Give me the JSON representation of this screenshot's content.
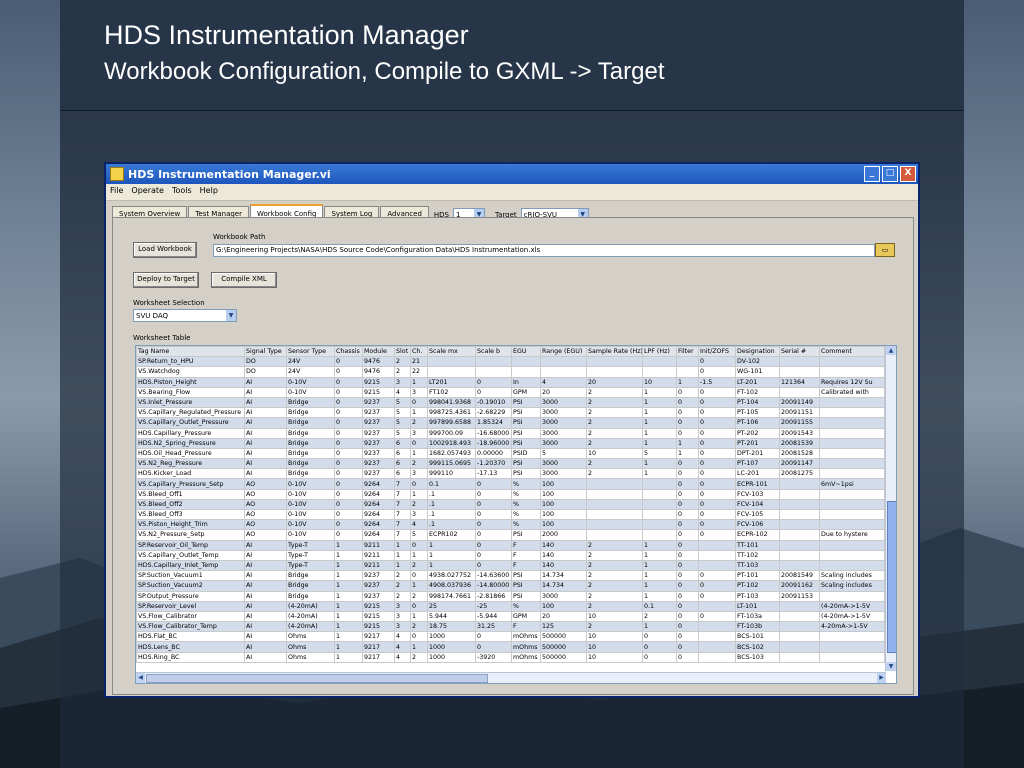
{
  "slide": {
    "title": "HDS Instrumentation Manager",
    "subtitle": "Workbook Configuration, Compile to GXML -> Target"
  },
  "window": {
    "title": "HDS Instrumentation Manager.vi",
    "controls": {
      "minimize": "_",
      "maximize": "□",
      "close": "X"
    }
  },
  "menu": [
    "File",
    "Operate",
    "Tools",
    "Help"
  ],
  "tabs": [
    "System Overview",
    "Test Manager",
    "Workbook Config",
    "System Log",
    "Advanced"
  ],
  "active_tab": "Workbook Config",
  "hds": {
    "label": "HDS",
    "value": "1"
  },
  "target": {
    "label": "Target",
    "value": "cRIO-SVU"
  },
  "workbook": {
    "path_label": "Workbook Path",
    "path_value": "G:\\Engineering Projects\\NASA\\HDS Source Code\\Configuration Data\\HDS Instrumentation.xls",
    "load_button": "Load Workbook",
    "deploy_button": "Deploy to Target",
    "compile_button": "Compile XML"
  },
  "worksheet": {
    "selection_label": "Worksheet Selection",
    "selection_value": "SVU DAQ",
    "table_label": "Worksheet Table"
  },
  "table": {
    "columns": [
      "Tag Name",
      "Signal Type",
      "Sensor Type",
      "Chassis",
      "Module",
      "Slot",
      "Ch.",
      "Scale mx",
      "Scale b",
      "EGU",
      "Range (EGU)",
      "Sample Rate (Hz)",
      "LPF (Hz)",
      "Filter",
      "Init/ZOFS",
      "Designation",
      "Serial #",
      "Comment"
    ],
    "rows": [
      [
        "SP.Return_to_HPU",
        "DO",
        "24V",
        "0",
        "9476",
        "2",
        "21",
        "",
        "",
        "",
        "",
        "",
        "",
        "",
        "0",
        "DV-102",
        "",
        ""
      ],
      [
        "VS.Watchdog",
        "DO",
        "24V",
        "0",
        "9476",
        "2",
        "22",
        "",
        "",
        "",
        "",
        "",
        "",
        "",
        "0",
        "WG-101",
        "",
        ""
      ],
      [
        "HDS.Piston_Height",
        "AI",
        "0-10V",
        "0",
        "9215",
        "3",
        "1",
        "LT201",
        "0",
        "In",
        "4",
        "20",
        "10",
        "1",
        "-1.5",
        "LT-201",
        "121364",
        "Requires 12V Su"
      ],
      [
        "VS.Bearing_Flow",
        "AI",
        "0-10V",
        "0",
        "9215",
        "4",
        "3",
        "FT102",
        "0",
        "GPM",
        "20",
        "2",
        "1",
        "0",
        "0",
        "FT-102",
        "",
        "Calibrated with"
      ],
      [
        "VS.Inlet_Pressure",
        "AI",
        "Bridge",
        "0",
        "9237",
        "5",
        "0",
        "998041.9368",
        "-0.19010",
        "PSI",
        "3000",
        "2",
        "1",
        "0",
        "0",
        "PT-104",
        "20091149",
        ""
      ],
      [
        "VS.Capillary_Regulated_Pressure",
        "AI",
        "Bridge",
        "0",
        "9237",
        "5",
        "1",
        "998725.4361",
        "-2.68229",
        "PSI",
        "3000",
        "2",
        "1",
        "0",
        "0",
        "PT-105",
        "20091151",
        ""
      ],
      [
        "VS.Capillary_Outlet_Pressure",
        "AI",
        "Bridge",
        "0",
        "9237",
        "5",
        "2",
        "997899.6588",
        "1.85324",
        "PSI",
        "3000",
        "2",
        "1",
        "0",
        "0",
        "PT-106",
        "20091155",
        ""
      ],
      [
        "HDS.Capillary_Pressure",
        "AI",
        "Bridge",
        "0",
        "9237",
        "5",
        "3",
        "999700.09",
        "-16.68000",
        "PSI",
        "3000",
        "2",
        "1",
        "0",
        "0",
        "PT-202",
        "20091543",
        ""
      ],
      [
        "HDS.N2_Spring_Pressure",
        "AI",
        "Bridge",
        "0",
        "9237",
        "6",
        "0",
        "1002918.493",
        "-18.96000",
        "PSI",
        "3000",
        "2",
        "1",
        "1",
        "0",
        "PT-201",
        "20081539",
        ""
      ],
      [
        "HDS.Oil_Head_Pressure",
        "AI",
        "Bridge",
        "0",
        "9237",
        "6",
        "1",
        "1682.057493",
        "0.00000",
        "PSID",
        "5",
        "10",
        "5",
        "1",
        "0",
        "DPT-201",
        "20081528",
        ""
      ],
      [
        "VS.N2_Reg_Pressure",
        "AI",
        "Bridge",
        "0",
        "9237",
        "6",
        "2",
        "999115.0695",
        "-1.20370",
        "PSI",
        "3000",
        "2",
        "1",
        "0",
        "0",
        "PT-107",
        "20091147",
        ""
      ],
      [
        "HDS.Kicker_Load",
        "AI",
        "Bridge",
        "0",
        "9237",
        "6",
        "3",
        "999110",
        "-17.13",
        "PSI",
        "3000",
        "2",
        "1",
        "0",
        "0",
        "LC-201",
        "20081275",
        ""
      ],
      [
        "VS.Capillary_Pressure_Setp",
        "AO",
        "0-10V",
        "0",
        "9264",
        "7",
        "0",
        "0.1",
        "0",
        "%",
        "100",
        "",
        "",
        "0",
        "0",
        "ECPR-101",
        "",
        "6mV~1psi"
      ],
      [
        "VS.Bleed_Off1",
        "AO",
        "0-10V",
        "0",
        "9264",
        "7",
        "1",
        ".1",
        "0",
        "%",
        "100",
        "",
        "",
        "0",
        "0",
        "FCV-103",
        "",
        ""
      ],
      [
        "VS.Bleed_Off2",
        "AO",
        "0-10V",
        "0",
        "9264",
        "7",
        "2",
        ".1",
        "0",
        "%",
        "100",
        "",
        "",
        "0",
        "0",
        "FCV-104",
        "",
        ""
      ],
      [
        "VS.Bleed_Off3",
        "AO",
        "0-10V",
        "0",
        "9264",
        "7",
        "3",
        ".1",
        "0",
        "%",
        "100",
        "",
        "",
        "0",
        "0",
        "FCV-105",
        "",
        ""
      ],
      [
        "VS.Piston_Height_Trim",
        "AO",
        "0-10V",
        "0",
        "9264",
        "7",
        "4",
        ".1",
        "0",
        "%",
        "100",
        "",
        "",
        "0",
        "0",
        "FCV-106",
        "",
        ""
      ],
      [
        "VS.N2_Pressure_Setp",
        "AO",
        "0-10V",
        "0",
        "9264",
        "7",
        "5",
        "ECPR102",
        "0",
        "PSI",
        "2000",
        "",
        "",
        "0",
        "0",
        "ECPR-102",
        "",
        "Due to hystere"
      ],
      [
        "SP.Reservoir_Oil_Temp",
        "AI",
        "Type-T",
        "1",
        "9211",
        "1",
        "0",
        "1",
        "0",
        "F",
        "140",
        "2",
        "1",
        "0",
        "",
        "TT-101",
        "",
        ""
      ],
      [
        "VS.Capillary_Outlet_Temp",
        "AI",
        "Type-T",
        "1",
        "9211",
        "1",
        "1",
        "1",
        "0",
        "F",
        "140",
        "2",
        "1",
        "0",
        "",
        "TT-102",
        "",
        ""
      ],
      [
        "HDS.Capillary_Inlet_Temp",
        "AI",
        "Type-T",
        "1",
        "9211",
        "1",
        "2",
        "1",
        "0",
        "F",
        "140",
        "2",
        "1",
        "0",
        "",
        "TT-103",
        "",
        ""
      ],
      [
        "SP.Suction_Vacuum1",
        "AI",
        "Bridge",
        "1",
        "9237",
        "2",
        "0",
        "4938.027752",
        "-14.63600",
        "PSI",
        "14.734",
        "2",
        "1",
        "0",
        "0",
        "PT-101",
        "20081549",
        "Scaling includes"
      ],
      [
        "SP.Suction_Vacuum2",
        "AI",
        "Bridge",
        "1",
        "9237",
        "2",
        "1",
        "4908.037936",
        "-14.80000",
        "PSI",
        "14.734",
        "2",
        "1",
        "0",
        "0",
        "PT-102",
        "20091162",
        "Scaling includes"
      ],
      [
        "SP.Output_Pressure",
        "AI",
        "Bridge",
        "1",
        "9237",
        "2",
        "2",
        "998174.7661",
        "-2.81866",
        "PSI",
        "3000",
        "2",
        "1",
        "0",
        "0",
        "PT-103",
        "20091153",
        ""
      ],
      [
        "SP.Reservoir_Level",
        "AI",
        "(4-20mA)",
        "1",
        "9215",
        "3",
        "0",
        "25",
        "-25",
        "%",
        "100",
        "2",
        "0.1",
        "0",
        "",
        "LT-101",
        "",
        "(4-20mA->1-5V"
      ],
      [
        "VS.Flow_Calibrator",
        "AI",
        "(4-20mA)",
        "1",
        "9215",
        "3",
        "1",
        "5.944",
        "-5.944",
        "GPM",
        "20",
        "10",
        "2",
        "0",
        "0",
        "FT-103a",
        "",
        "(4-20mA->1-5V"
      ],
      [
        "VS.Flow_Calibrator_Temp",
        "AI",
        "(4-20mA)",
        "1",
        "9215",
        "3",
        "2",
        "18.75",
        "31.25",
        "F",
        "125",
        "2",
        "1",
        "0",
        "",
        "FT-103b",
        "",
        "4-20mA->1-5V"
      ],
      [
        "HDS.Flat_BC",
        "AI",
        "Ohms",
        "1",
        "9217",
        "4",
        "0",
        "1000",
        "0",
        "mOhms",
        "500000",
        "10",
        "0",
        "0",
        "",
        "BCS-101",
        "",
        ""
      ],
      [
        "HDS.Lens_BC",
        "AI",
        "Ohms",
        "1",
        "9217",
        "4",
        "1",
        "1000",
        "0",
        "mOhms",
        "500000",
        "10",
        "0",
        "0",
        "",
        "BCS-102",
        "",
        ""
      ],
      [
        "HDS.Ring_BC",
        "AI",
        "Ohms",
        "1",
        "9217",
        "4",
        "2",
        "1000",
        "-3920",
        "mOhms",
        "500000",
        "10",
        "0",
        "0",
        "",
        "BCS-103",
        "",
        ""
      ]
    ]
  },
  "icons": {
    "folder": "folder-open-icon",
    "dropdown": "chevron-down-icon"
  }
}
